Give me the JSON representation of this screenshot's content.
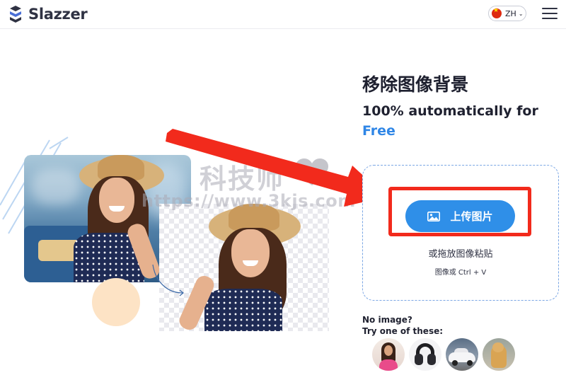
{
  "header": {
    "brand": "Slazzer",
    "language": {
      "code": "ZH",
      "flag": "china-flag-icon"
    }
  },
  "hero": {
    "title": "移除图像背景",
    "subtitle_line1": "100% automatically for",
    "subtitle_free": "Free"
  },
  "upload": {
    "button_label": "上传图片",
    "drop_hint": "或拖放图像粘贴",
    "paste_hint": "图像或 Ctrl + V"
  },
  "samples": {
    "prompt_line1": "No image?",
    "prompt_line2": "Try one of these:",
    "items": [
      "woman",
      "headphones",
      "car",
      "dog"
    ]
  },
  "watermark": {
    "title": "科技师",
    "url": "https://www.3kjs.com"
  },
  "colors": {
    "accent": "#2f8fe8",
    "free_text": "#2f86e6",
    "highlight_red": "#f22a1c",
    "peach": "#fde3c5"
  }
}
